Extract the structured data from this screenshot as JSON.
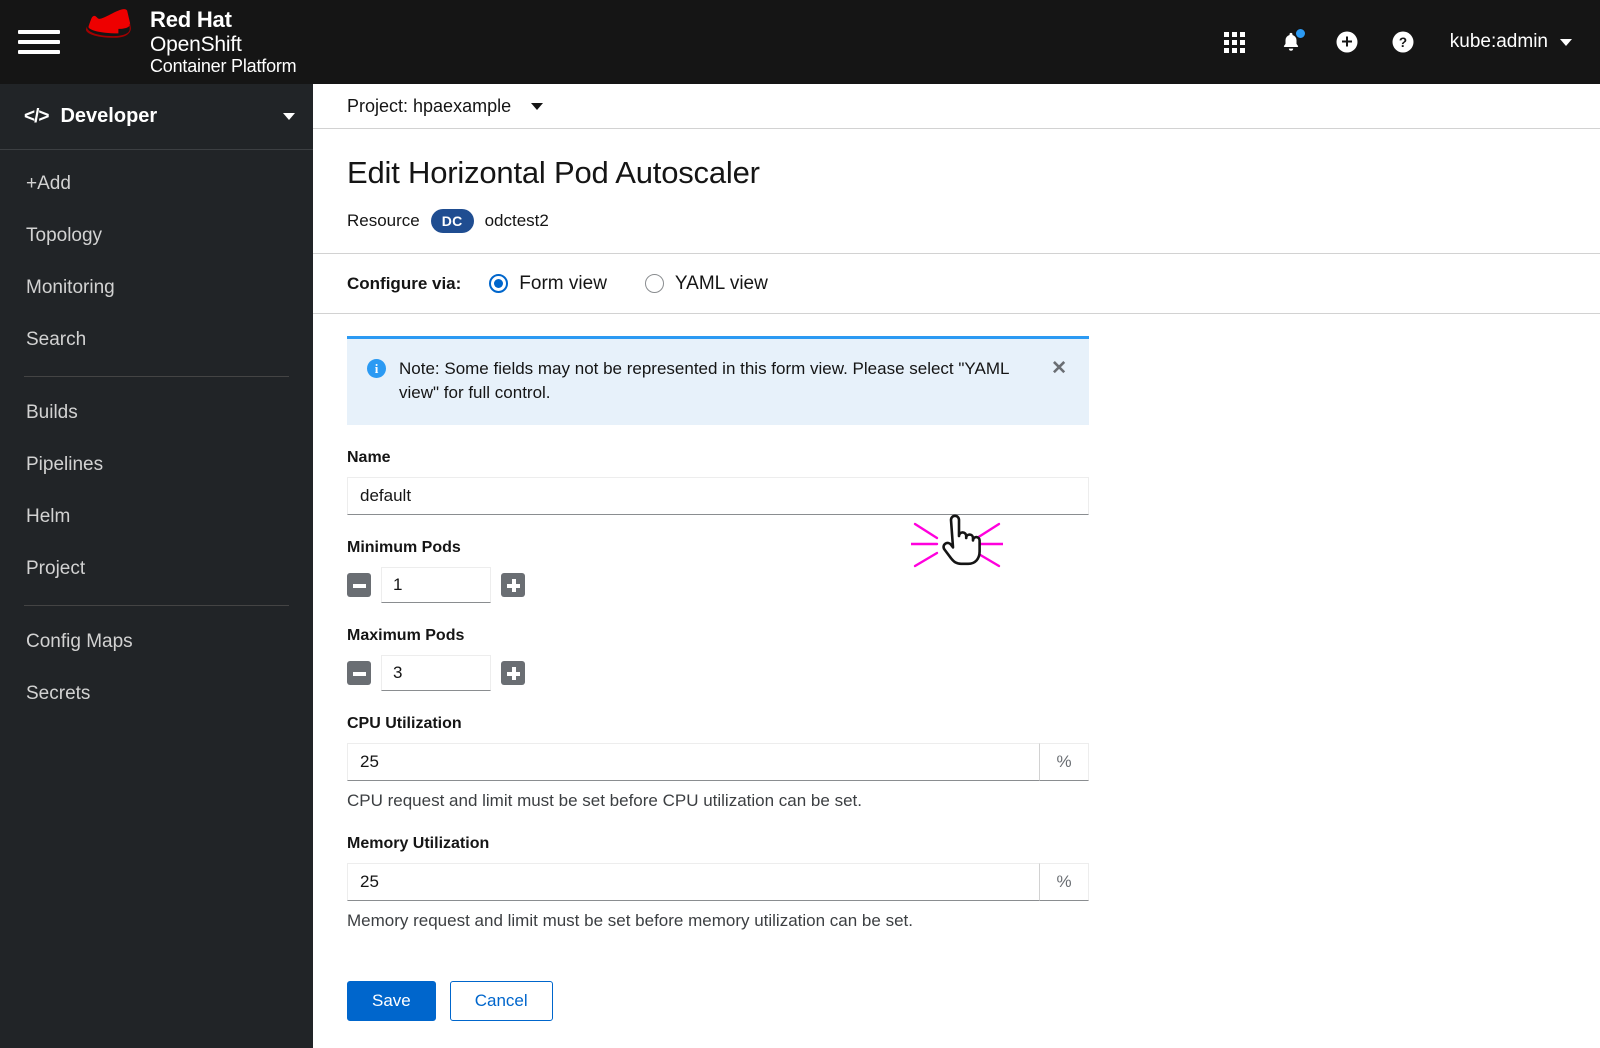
{
  "masthead": {
    "hamburger": "menu-toggle",
    "brand": {
      "line1": "Red Hat",
      "line2": "OpenShift",
      "line3": "Container Platform"
    },
    "icons": [
      "app-launcher-icon",
      "notification-bell-icon",
      "plus-circle-icon",
      "help-circle-icon"
    ],
    "user": "kube:admin"
  },
  "sidebar": {
    "perspective": "Developer",
    "groups": [
      {
        "items": [
          "+Add",
          "Topology",
          "Monitoring",
          "Search"
        ]
      },
      {
        "items": [
          "Builds",
          "Pipelines",
          "Helm",
          "Project"
        ]
      },
      {
        "items": [
          "Config Maps",
          "Secrets"
        ]
      }
    ]
  },
  "project_bar": {
    "label": "Project: hpaexample"
  },
  "page": {
    "title": "Edit Horizontal Pod Autoscaler",
    "resource_label": "Resource",
    "resource_badge": "DC",
    "resource_name": "odctest2"
  },
  "configure": {
    "label": "Configure via:",
    "options": [
      {
        "label": "Form view",
        "selected": true
      },
      {
        "label": "YAML view",
        "selected": false
      }
    ]
  },
  "alert": {
    "text": "Note: Some fields may not be represented in this form view. Please select \"YAML view\" for full control.",
    "close": "✕"
  },
  "form": {
    "name": {
      "label": "Name",
      "value": "default"
    },
    "min_pods": {
      "label": "Minimum Pods",
      "value": "1"
    },
    "max_pods": {
      "label": "Maximum Pods",
      "value": "3"
    },
    "cpu": {
      "label": "CPU Utilization",
      "value": "25",
      "suffix": "%",
      "help": "CPU request and limit must be set before CPU utilization can be set."
    },
    "memory": {
      "label": "Memory Utilization",
      "value": "25",
      "suffix": "%",
      "help": "Memory request and limit must be set before memory utilization can be set."
    }
  },
  "actions": {
    "save": "Save",
    "cancel": "Cancel"
  },
  "colors": {
    "masthead_bg": "#151515",
    "sidebar_bg": "#212427",
    "primary_blue": "#0066cc",
    "info_blue": "#2b9af3",
    "alert_bg": "#e7f1fa",
    "badge_navy": "#1f4d91",
    "cursor_highlight": "#ff00dd"
  }
}
